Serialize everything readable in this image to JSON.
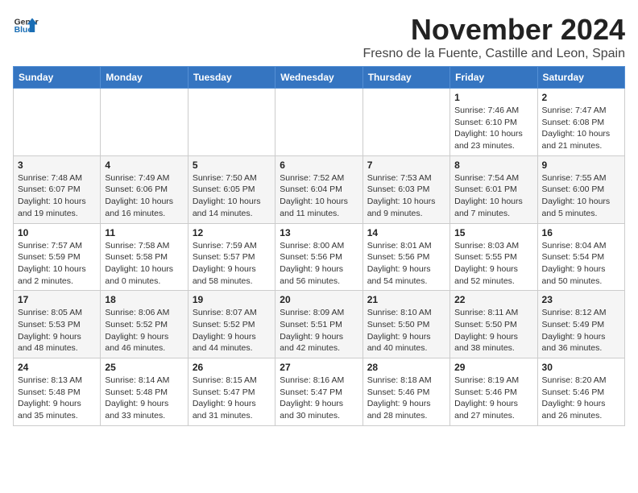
{
  "logo": {
    "line1": "General",
    "line2": "Blue"
  },
  "title": "November 2024",
  "location": "Fresno de la Fuente, Castille and Leon, Spain",
  "weekdays": [
    "Sunday",
    "Monday",
    "Tuesday",
    "Wednesday",
    "Thursday",
    "Friday",
    "Saturday"
  ],
  "weeks": [
    [
      {
        "day": "",
        "info": ""
      },
      {
        "day": "",
        "info": ""
      },
      {
        "day": "",
        "info": ""
      },
      {
        "day": "",
        "info": ""
      },
      {
        "day": "",
        "info": ""
      },
      {
        "day": "1",
        "info": "Sunrise: 7:46 AM\nSunset: 6:10 PM\nDaylight: 10 hours and 23 minutes."
      },
      {
        "day": "2",
        "info": "Sunrise: 7:47 AM\nSunset: 6:08 PM\nDaylight: 10 hours and 21 minutes."
      }
    ],
    [
      {
        "day": "3",
        "info": "Sunrise: 7:48 AM\nSunset: 6:07 PM\nDaylight: 10 hours and 19 minutes."
      },
      {
        "day": "4",
        "info": "Sunrise: 7:49 AM\nSunset: 6:06 PM\nDaylight: 10 hours and 16 minutes."
      },
      {
        "day": "5",
        "info": "Sunrise: 7:50 AM\nSunset: 6:05 PM\nDaylight: 10 hours and 14 minutes."
      },
      {
        "day": "6",
        "info": "Sunrise: 7:52 AM\nSunset: 6:04 PM\nDaylight: 10 hours and 11 minutes."
      },
      {
        "day": "7",
        "info": "Sunrise: 7:53 AM\nSunset: 6:03 PM\nDaylight: 10 hours and 9 minutes."
      },
      {
        "day": "8",
        "info": "Sunrise: 7:54 AM\nSunset: 6:01 PM\nDaylight: 10 hours and 7 minutes."
      },
      {
        "day": "9",
        "info": "Sunrise: 7:55 AM\nSunset: 6:00 PM\nDaylight: 10 hours and 5 minutes."
      }
    ],
    [
      {
        "day": "10",
        "info": "Sunrise: 7:57 AM\nSunset: 5:59 PM\nDaylight: 10 hours and 2 minutes."
      },
      {
        "day": "11",
        "info": "Sunrise: 7:58 AM\nSunset: 5:58 PM\nDaylight: 10 hours and 0 minutes."
      },
      {
        "day": "12",
        "info": "Sunrise: 7:59 AM\nSunset: 5:57 PM\nDaylight: 9 hours and 58 minutes."
      },
      {
        "day": "13",
        "info": "Sunrise: 8:00 AM\nSunset: 5:56 PM\nDaylight: 9 hours and 56 minutes."
      },
      {
        "day": "14",
        "info": "Sunrise: 8:01 AM\nSunset: 5:56 PM\nDaylight: 9 hours and 54 minutes."
      },
      {
        "day": "15",
        "info": "Sunrise: 8:03 AM\nSunset: 5:55 PM\nDaylight: 9 hours and 52 minutes."
      },
      {
        "day": "16",
        "info": "Sunrise: 8:04 AM\nSunset: 5:54 PM\nDaylight: 9 hours and 50 minutes."
      }
    ],
    [
      {
        "day": "17",
        "info": "Sunrise: 8:05 AM\nSunset: 5:53 PM\nDaylight: 9 hours and 48 minutes."
      },
      {
        "day": "18",
        "info": "Sunrise: 8:06 AM\nSunset: 5:52 PM\nDaylight: 9 hours and 46 minutes."
      },
      {
        "day": "19",
        "info": "Sunrise: 8:07 AM\nSunset: 5:52 PM\nDaylight: 9 hours and 44 minutes."
      },
      {
        "day": "20",
        "info": "Sunrise: 8:09 AM\nSunset: 5:51 PM\nDaylight: 9 hours and 42 minutes."
      },
      {
        "day": "21",
        "info": "Sunrise: 8:10 AM\nSunset: 5:50 PM\nDaylight: 9 hours and 40 minutes."
      },
      {
        "day": "22",
        "info": "Sunrise: 8:11 AM\nSunset: 5:50 PM\nDaylight: 9 hours and 38 minutes."
      },
      {
        "day": "23",
        "info": "Sunrise: 8:12 AM\nSunset: 5:49 PM\nDaylight: 9 hours and 36 minutes."
      }
    ],
    [
      {
        "day": "24",
        "info": "Sunrise: 8:13 AM\nSunset: 5:48 PM\nDaylight: 9 hours and 35 minutes."
      },
      {
        "day": "25",
        "info": "Sunrise: 8:14 AM\nSunset: 5:48 PM\nDaylight: 9 hours and 33 minutes."
      },
      {
        "day": "26",
        "info": "Sunrise: 8:15 AM\nSunset: 5:47 PM\nDaylight: 9 hours and 31 minutes."
      },
      {
        "day": "27",
        "info": "Sunrise: 8:16 AM\nSunset: 5:47 PM\nDaylight: 9 hours and 30 minutes."
      },
      {
        "day": "28",
        "info": "Sunrise: 8:18 AM\nSunset: 5:46 PM\nDaylight: 9 hours and 28 minutes."
      },
      {
        "day": "29",
        "info": "Sunrise: 8:19 AM\nSunset: 5:46 PM\nDaylight: 9 hours and 27 minutes."
      },
      {
        "day": "30",
        "info": "Sunrise: 8:20 AM\nSunset: 5:46 PM\nDaylight: 9 hours and 26 minutes."
      }
    ]
  ]
}
